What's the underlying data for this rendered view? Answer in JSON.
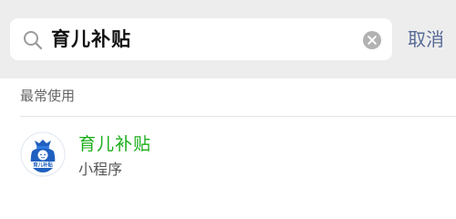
{
  "search": {
    "query": "育儿补贴",
    "cancel_label": "取消"
  },
  "section": {
    "label": "最常使用"
  },
  "results": [
    {
      "title": "育儿补贴",
      "subtitle": "小程序",
      "logo_text": "育儿补贴",
      "logo_color": "#1f5fbf"
    }
  ],
  "colors": {
    "accent_link": "#576b95",
    "highlight": "#1aad19",
    "header_bg": "#ededed"
  },
  "icons": [
    "search-icon",
    "clear-icon",
    "app-logo"
  ]
}
